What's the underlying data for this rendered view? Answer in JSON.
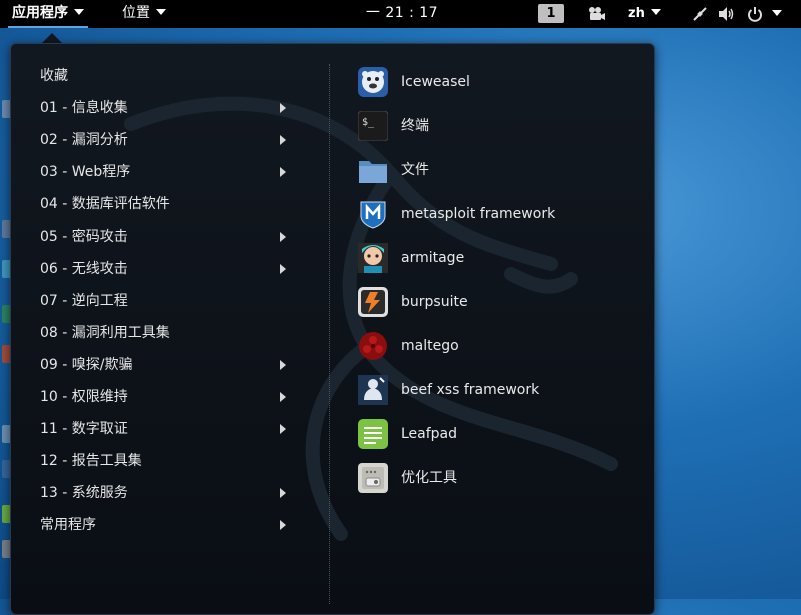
{
  "topbar": {
    "apps_label": "应用程序",
    "places_label": "位置",
    "clock": "一 21 : 17",
    "workspace": "1",
    "lang": "zh"
  },
  "menu": {
    "categories": [
      {
        "label": "收藏",
        "submenu": false
      },
      {
        "label": "01 - 信息收集",
        "submenu": true
      },
      {
        "label": "02 - 漏洞分析",
        "submenu": true
      },
      {
        "label": "03 - Web程序",
        "submenu": true
      },
      {
        "label": "04 - 数据库评估软件",
        "submenu": false
      },
      {
        "label": "05 - 密码攻击",
        "submenu": true
      },
      {
        "label": "06 - 无线攻击",
        "submenu": true
      },
      {
        "label": "07 - 逆向工程",
        "submenu": false
      },
      {
        "label": "08 - 漏洞利用工具集",
        "submenu": false
      },
      {
        "label": "09 - 嗅探/欺骗",
        "submenu": true
      },
      {
        "label": "10 - 权限维持",
        "submenu": true
      },
      {
        "label": "11 - 数字取证",
        "submenu": true
      },
      {
        "label": "12 - 报告工具集",
        "submenu": false
      },
      {
        "label": "13 - 系统服务",
        "submenu": true
      },
      {
        "label": "常用程序",
        "submenu": true
      }
    ],
    "apps": [
      {
        "label": "Iceweasel",
        "icon": "iceweasel-icon"
      },
      {
        "label": "终端",
        "icon": "terminal-icon"
      },
      {
        "label": "文件",
        "icon": "folder-icon"
      },
      {
        "label": "metasploit framework",
        "icon": "metasploit-icon"
      },
      {
        "label": "armitage",
        "icon": "armitage-icon"
      },
      {
        "label": "burpsuite",
        "icon": "burpsuite-icon"
      },
      {
        "label": "maltego",
        "icon": "maltego-icon"
      },
      {
        "label": "beef xss framework",
        "icon": "beef-icon"
      },
      {
        "label": "Leafpad",
        "icon": "leafpad-icon"
      },
      {
        "label": "优化工具",
        "icon": "tweak-tool-icon"
      }
    ]
  },
  "colors": {
    "desktop": "#1f6fb5",
    "panel": "#000000",
    "menu_bg": "#0d1219",
    "accent": "#5da6e0"
  }
}
